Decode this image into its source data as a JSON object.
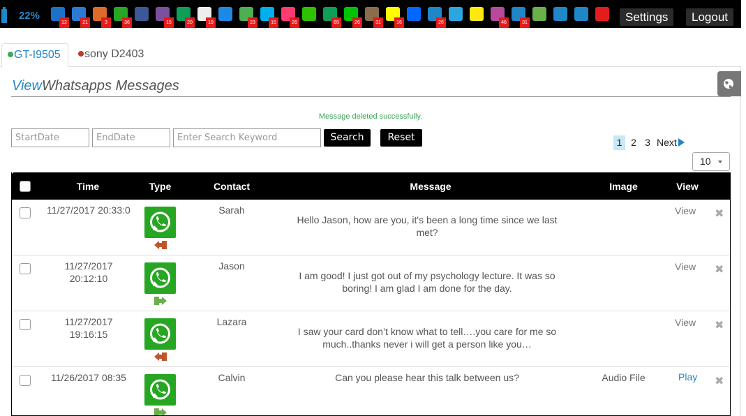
{
  "status_bar": {
    "battery_percent": "22%",
    "apps": [
      {
        "icon": "phone-icon",
        "color": "#1a73c8",
        "badge": "12"
      },
      {
        "icon": "mail-icon",
        "color": "#2b7bd4",
        "badge": "21"
      },
      {
        "icon": "messages-icon",
        "color": "#e06a2b",
        "badge": "3"
      },
      {
        "icon": "whatsapp-icon",
        "color": "#27a623",
        "badge": "36"
      },
      {
        "icon": "facebook-icon",
        "color": "#3b5998",
        "badge": ""
      },
      {
        "icon": "viber-icon",
        "color": "#7b519d",
        "badge": "15"
      },
      {
        "icon": "hangouts-icon",
        "color": "#0f9d58",
        "badge": "20"
      },
      {
        "icon": "gmail-icon",
        "color": "#eeeeee",
        "badge": "19"
      },
      {
        "icon": "hike-icon",
        "color": "#1e88e5",
        "badge": ""
      },
      {
        "icon": "kik-icon",
        "color": "#4caf50",
        "badge": "23"
      },
      {
        "icon": "skype-icon",
        "color": "#00aff0",
        "badge": "15"
      },
      {
        "icon": "tinder-icon",
        "color": "#fe3c72",
        "badge": "26"
      },
      {
        "icon": "wechat-icon",
        "color": "#2dc100",
        "badge": ""
      },
      {
        "icon": "hangouts-chat-icon",
        "color": "#0f9d58",
        "badge": "65"
      },
      {
        "icon": "line-icon",
        "color": "#00c300",
        "badge": "26"
      },
      {
        "icon": "instagram-icon",
        "color": "#8a6d4b",
        "badge": "31"
      },
      {
        "icon": "snapchat-icon",
        "color": "#fffc00",
        "badge": "16"
      },
      {
        "icon": "zalo-icon",
        "color": "#0068ff",
        "badge": ""
      },
      {
        "icon": "imo-icon",
        "color": "#1f86c8",
        "badge": "26"
      },
      {
        "icon": "telegram-icon",
        "color": "#2ca5e0",
        "badge": ""
      },
      {
        "icon": "kakaotalk-icon",
        "color": "#ffe812",
        "badge": ""
      },
      {
        "icon": "gallery-icon",
        "color": "#b84a9e",
        "badge": "46"
      },
      {
        "icon": "browser-icon",
        "color": "#1f86c8",
        "badge": "31"
      },
      {
        "icon": "download-icon",
        "color": "#6ab04c",
        "badge": ""
      },
      {
        "icon": "dollar-icon",
        "color": "#1f86c8",
        "badge": ""
      },
      {
        "icon": "help-icon",
        "color": "#1f86c8",
        "badge": ""
      },
      {
        "icon": "alarm-icon",
        "color": "#e31c1c",
        "badge": ""
      }
    ],
    "settings_label": "Settings",
    "logout_label": "Logout"
  },
  "tabs": [
    {
      "label": "GT-I9505",
      "status_color": "#3ea65a",
      "active": true
    },
    {
      "label": "sony D2403",
      "status_color": "#c0392b",
      "active": false
    }
  ],
  "heading": {
    "prefix": "View",
    "rest": "Whatsapps Messages"
  },
  "status_message": "Message deleted successfully.",
  "filters": {
    "start_placeholder": "StartDate",
    "end_placeholder": "EndDate",
    "search_placeholder": "Enter Search Keyword",
    "search_label": "Search",
    "reset_label": "Reset"
  },
  "pagination": {
    "pages": [
      "1",
      "2",
      "3"
    ],
    "current": "1",
    "next_label": "Next",
    "page_size": "10"
  },
  "table": {
    "headers": {
      "time": "Time",
      "type": "Type",
      "contact": "Contact",
      "message": "Message",
      "image": "Image",
      "view": "View"
    },
    "rows": [
      {
        "time_line1": "11/27/2017 20:33:0",
        "time_line2": "",
        "direction": "incoming",
        "contact": "Sarah",
        "message_line1": "Hello Jason, how are you, it's been a long time since we last",
        "message_line2": "met?",
        "image": "",
        "action": "View"
      },
      {
        "time_line1": "11/27/2017",
        "time_line2": "20:12:10",
        "direction": "outgoing",
        "contact": "Jason",
        "message_line1": "I am good! I just got out of my psychology lecture. It was so",
        "message_line2": "boring! I am glad I am done for the day.",
        "image": "",
        "action": "View"
      },
      {
        "time_line1": "11/27/2017",
        "time_line2": "19:16:15",
        "direction": "incoming",
        "contact": "Lazara",
        "message_line1": "I saw your card don’t know what to tell….you care for me so",
        "message_line2": "much..thanks never i will get a person like you…",
        "image": "",
        "action": "View"
      },
      {
        "time_line1": "11/26/2017 08:35",
        "time_line2": "",
        "direction": "outgoing",
        "contact": "Calvin",
        "message_line1": "Can you please hear this talk between us?",
        "message_line2": "",
        "image": "Audio File",
        "action": "Play"
      }
    ]
  },
  "colors": {
    "accent": "#1f86c8",
    "whatsapp_green": "#27a623",
    "incoming_arrow": "#c0552b",
    "outgoing_arrow": "#6ab04c",
    "success": "#3ea65a"
  }
}
